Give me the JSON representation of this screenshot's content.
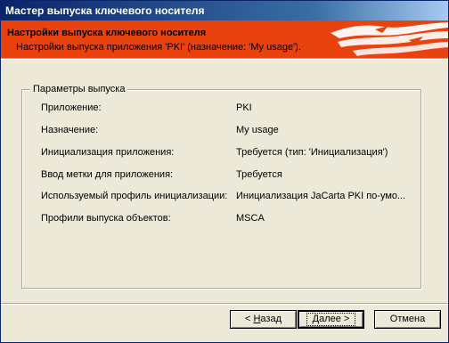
{
  "window": {
    "title": "Мастер выпуска ключевого носителя"
  },
  "banner": {
    "title": "Настройки выпуска ключевого носителя",
    "subtitle": "Настройки выпуска приложения 'PKI' (назначение: 'My usage').",
    "background_color": "#e8420f"
  },
  "group": {
    "legend": "Параметры выпуска",
    "rows": [
      {
        "label": "Приложение:",
        "value": "PKI"
      },
      {
        "label": "Назначение:",
        "value": "My usage"
      },
      {
        "label": "Инициализация приложения:",
        "value": "Требуется (тип: 'Инициализация')"
      },
      {
        "label": "Ввод метки для приложения:",
        "value": "Требуется"
      },
      {
        "label": "Используемый профиль инициализации:",
        "value": "Инициализация JaCarta PKI по-умо..."
      },
      {
        "label": "Профили выпуска объектов:",
        "value": "MSCA"
      }
    ]
  },
  "buttons": {
    "back": {
      "prefix": "< ",
      "mnemonic": "Н",
      "rest": "азад"
    },
    "next": {
      "mnemonic": "Д",
      "rest": "алее >"
    },
    "cancel": {
      "label": "Отмена"
    }
  },
  "colors": {
    "titlebar": "#0a246a",
    "face": "#ece9d8"
  }
}
